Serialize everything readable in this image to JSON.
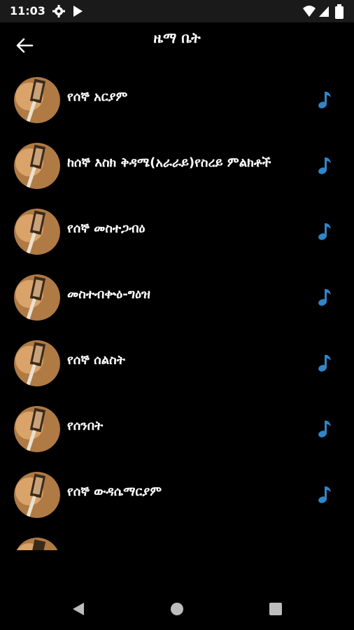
{
  "status_bar": {
    "time": "11:03",
    "icons": [
      "gear-icon",
      "play-icon",
      "wifi-icon",
      "signal-icon",
      "battery-icon"
    ]
  },
  "app_bar": {
    "title": "ዜማ ቤት",
    "back_icon": "arrow-left-icon"
  },
  "songs": [
    {
      "title": "የሰኞ አርያም"
    },
    {
      "title": "ከሰኞ እስክ ቅዳሜ(አራራይ)የስረይ ምልክቶች"
    },
    {
      "title": "የሰኞ መስተጋብዕ"
    },
    {
      "title": "መስተብቍዕ-ግዕዝ"
    },
    {
      "title": "የሰኞ ሰልስት"
    },
    {
      "title": "የሰንበት"
    },
    {
      "title": "የሰኞ ውዳሴማርያም"
    },
    {
      "title": ""
    }
  ],
  "colors": {
    "background": "#000000",
    "status_bar": "#1a1a1a",
    "accent_note": "#2f86c9"
  },
  "nav_bar": {
    "icons": [
      "back-triangle-icon",
      "home-circle-icon",
      "recents-square-icon"
    ]
  }
}
